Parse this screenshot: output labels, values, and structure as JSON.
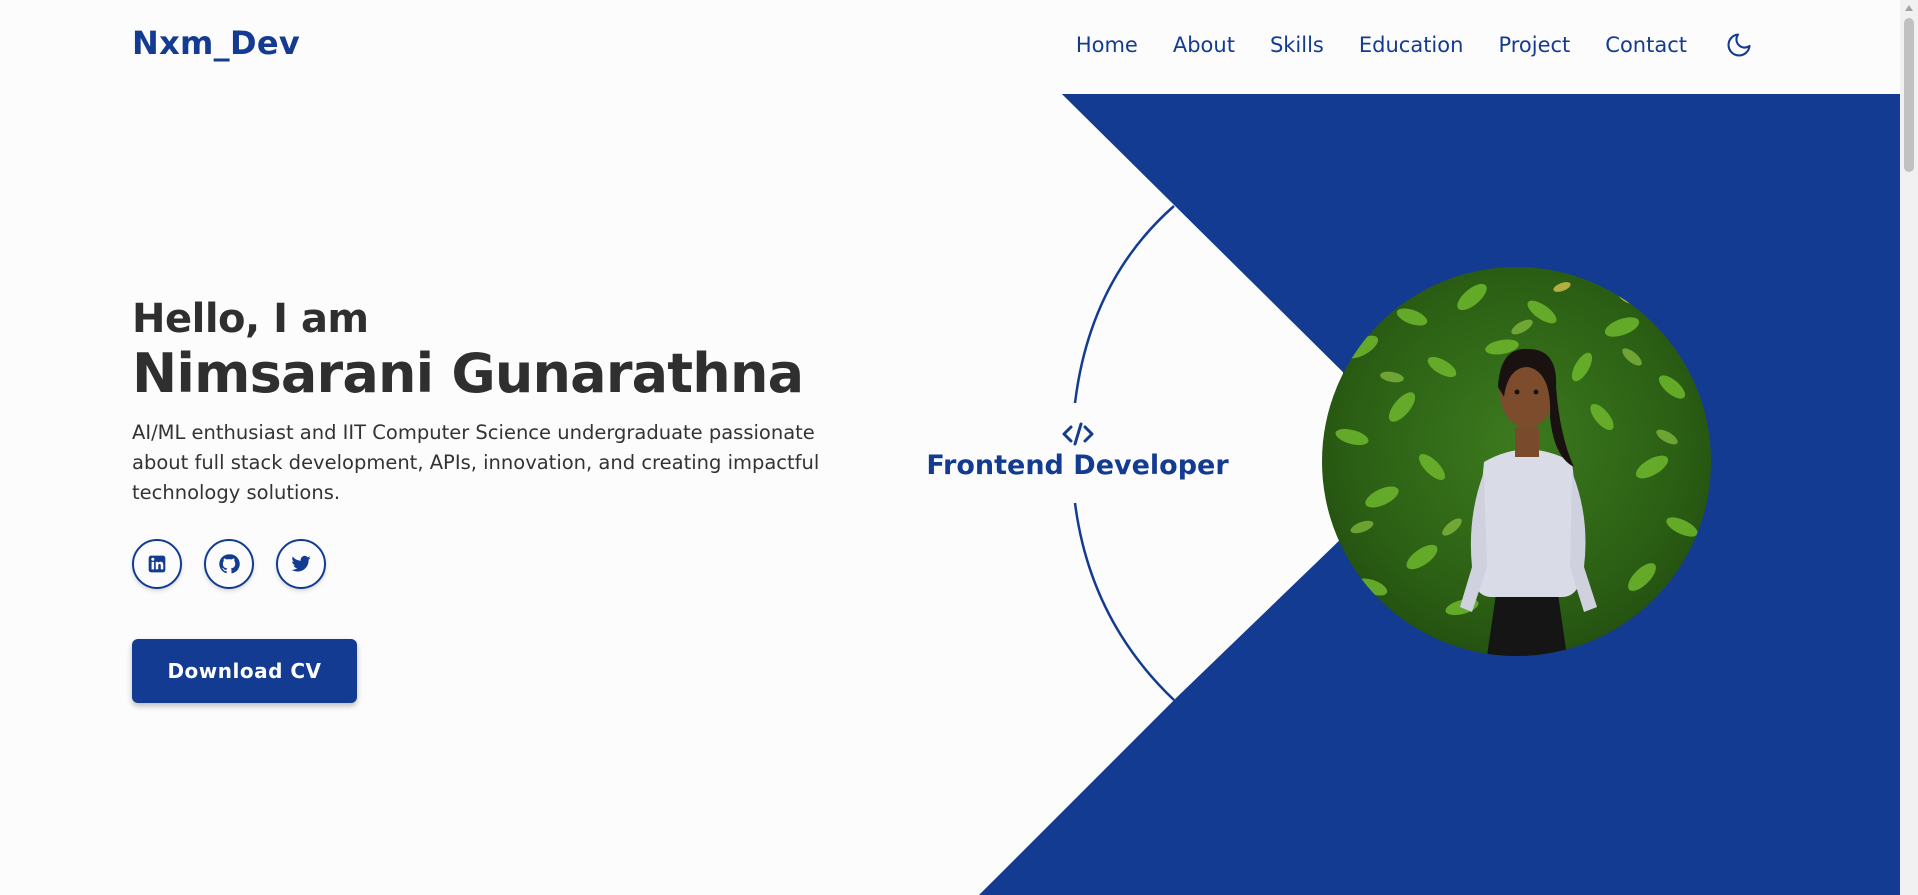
{
  "header": {
    "logo": "Nxm_Dev",
    "nav": [
      "Home",
      "About",
      "Skills",
      "Education",
      "Project",
      "Contact"
    ],
    "theme_toggle_icon": "moon-icon"
  },
  "hero": {
    "greeting": "Hello, I am",
    "name": "Nimsarani Gunarathna",
    "description": "AI/ML enthusiast and IIT Computer Science undergraduate passionate about full stack development, APIs, innovation, and creating impactful technology solutions.",
    "socials": [
      {
        "icon": "linkedin-icon"
      },
      {
        "icon": "github-icon"
      },
      {
        "icon": "twitter-icon"
      }
    ],
    "cta_label": "Download CV",
    "role_icon": "code-icon",
    "role": "Frontend Developer",
    "portrait": "profile-photo"
  },
  "colors": {
    "brand": "#133b91",
    "background": "#fcfcfd",
    "text": "#2f2f2f"
  }
}
